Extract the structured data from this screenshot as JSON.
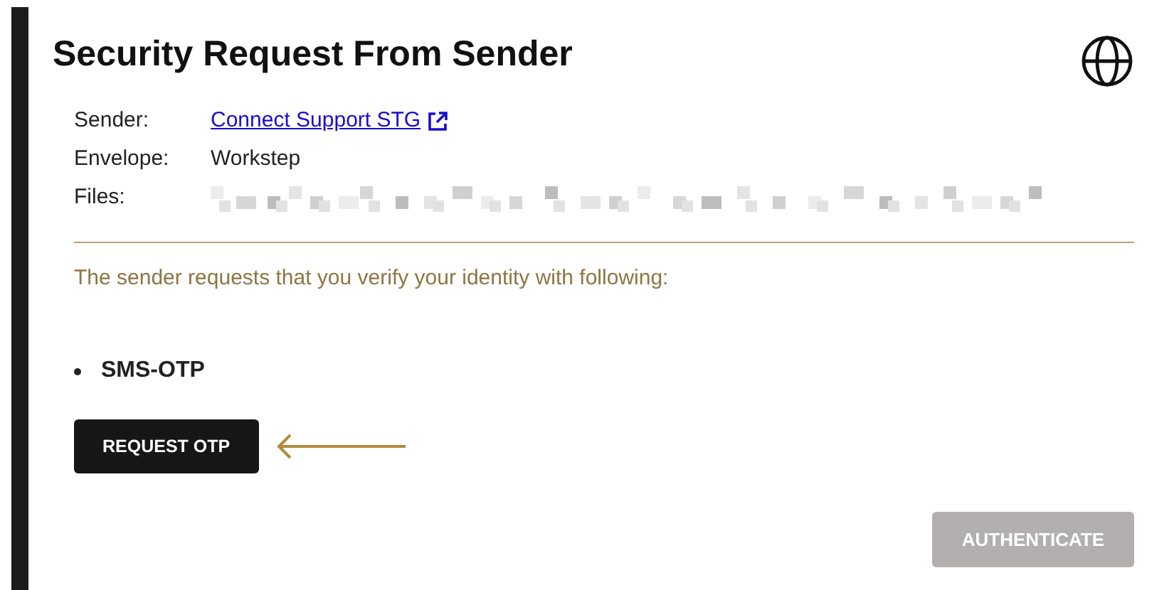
{
  "title": "Security Request From Sender",
  "details": [
    {
      "label": "Sender:",
      "value": "Connect Support STG",
      "kind": "link"
    },
    {
      "label": "Envelope:",
      "value": "Workstep",
      "kind": "text"
    },
    {
      "label": "Files:",
      "kind": "redacted"
    }
  ],
  "message": "The sender requests that you verify your identity with following:",
  "methods": [
    "SMS-OTP"
  ],
  "request_button": {
    "label": "REQUEST OTP",
    "disabled": false
  },
  "authenticate_button": {
    "label": "AUTHENTICATE",
    "disabled": true
  }
}
